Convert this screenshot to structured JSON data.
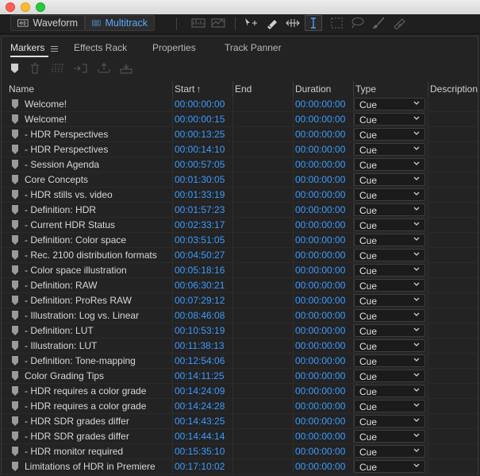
{
  "window": {
    "traffic_lights": [
      "close",
      "minimize",
      "zoom"
    ]
  },
  "toolbar": {
    "waveform_label": "Waveform",
    "multitrack_label": "Multitrack",
    "accent_color": "#5aa9ff"
  },
  "tabs": [
    {
      "label": "Markers",
      "active": true
    },
    {
      "label": "Effects Rack"
    },
    {
      "label": "Properties"
    },
    {
      "label": "Track Panner"
    }
  ],
  "columns": {
    "name": "Name",
    "start": "Start",
    "start_sort": "↑",
    "end": "End",
    "duration": "Duration",
    "type": "Type",
    "description": "Description"
  },
  "markers": [
    {
      "name": "Welcome!",
      "start": "00:00:00:00",
      "duration": "00:00:00:00",
      "type": "Cue"
    },
    {
      "name": "Welcome!",
      "start": "00:00:00:15",
      "duration": "00:00:00:00",
      "type": "Cue"
    },
    {
      "name": " - HDR Perspectives",
      "start": "00:00:13:25",
      "duration": "00:00:00:00",
      "type": "Cue"
    },
    {
      "name": " - HDR Perspectives",
      "start": "00:00:14:10",
      "duration": "00:00:00:00",
      "type": "Cue"
    },
    {
      "name": " - Session Agenda",
      "start": "00:00:57:05",
      "duration": "00:00:00:00",
      "type": "Cue"
    },
    {
      "name": "Core Concepts",
      "start": "00:01:30:05",
      "duration": "00:00:00:00",
      "type": "Cue"
    },
    {
      "name": " - HDR stills vs. video",
      "start": "00:01:33:19",
      "duration": "00:00:00:00",
      "type": "Cue"
    },
    {
      "name": " - Definition: HDR",
      "start": "00:01:57:23",
      "duration": "00:00:00:00",
      "type": "Cue"
    },
    {
      "name": " - Current HDR Status",
      "start": "00:02:33:17",
      "duration": "00:00:00:00",
      "type": "Cue"
    },
    {
      "name": " - Definition: Color space",
      "start": "00:03:51:05",
      "duration": "00:00:00:00",
      "type": "Cue"
    },
    {
      "name": " - Rec. 2100 distribution formats",
      "start": "00:04:50:27",
      "duration": "00:00:00:00",
      "type": "Cue"
    },
    {
      "name": " - Color space illustration",
      "start": "00:05:18:16",
      "duration": "00:00:00:00",
      "type": "Cue"
    },
    {
      "name": " - Definition: RAW",
      "start": "00:06:30:21",
      "duration": "00:00:00:00",
      "type": "Cue"
    },
    {
      "name": " - Definition: ProRes RAW",
      "start": "00:07:29:12",
      "duration": "00:00:00:00",
      "type": "Cue"
    },
    {
      "name": " - Illustration: Log vs. Linear",
      "start": "00:08:46:08",
      "duration": "00:00:00:00",
      "type": "Cue"
    },
    {
      "name": " - Definition: LUT",
      "start": "00:10:53:19",
      "duration": "00:00:00:00",
      "type": "Cue"
    },
    {
      "name": " - Illustration: LUT",
      "start": "00:11:38:13",
      "duration": "00:00:00:00",
      "type": "Cue"
    },
    {
      "name": " - Definition: Tone-mapping",
      "start": "00:12:54:06",
      "duration": "00:00:00:00",
      "type": "Cue"
    },
    {
      "name": "Color Grading Tips",
      "start": "00:14:11:25",
      "duration": "00:00:00:00",
      "type": "Cue"
    },
    {
      "name": " - HDR requires a color grade",
      "start": "00:14:24:09",
      "duration": "00:00:00:00",
      "type": "Cue"
    },
    {
      "name": " - HDR requires a color grade",
      "start": "00:14:24:28",
      "duration": "00:00:00:00",
      "type": "Cue"
    },
    {
      "name": " - HDR  SDR grades differ",
      "start": "00:14:43:25",
      "duration": "00:00:00:00",
      "type": "Cue"
    },
    {
      "name": " - HDR  SDR grades differ",
      "start": "00:14:44:14",
      "duration": "00:00:00:00",
      "type": "Cue"
    },
    {
      "name": " - HDR monitor required",
      "start": "00:15:35:10",
      "duration": "00:00:00:00",
      "type": "Cue"
    },
    {
      "name": "Limitations of HDR in Premiere",
      "start": "00:17:10:02",
      "duration": "00:00:00:00",
      "type": "Cue"
    }
  ]
}
